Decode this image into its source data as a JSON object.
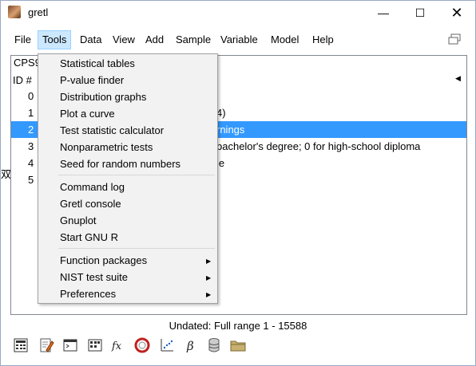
{
  "window": {
    "title": "gretl",
    "min_glyph": "—",
    "max_glyph": "☐",
    "close_glyph": "✕"
  },
  "menubar": {
    "items": [
      {
        "label": "File",
        "accel": "F"
      },
      {
        "label": "Tools",
        "accel": "T"
      },
      {
        "label": "Data",
        "accel": "D"
      },
      {
        "label": "View",
        "accel": "V"
      },
      {
        "label": "Add",
        "accel": "A"
      },
      {
        "label": "Sample",
        "accel": "S"
      },
      {
        "label": "Variable",
        "accel": "V"
      },
      {
        "label": "Model",
        "accel": "M"
      },
      {
        "label": "Help",
        "accel": "H"
      }
    ],
    "active": "Tools"
  },
  "main": {
    "dataset_label": "CPS9",
    "header_id": "ID #",
    "header_arrow": "◀",
    "rows": [
      {
        "idx": "0",
        "desc": ""
      },
      {
        "idx": "1",
        "desc": "4)"
      },
      {
        "idx": "2",
        "desc": "rnings"
      },
      {
        "idx": "3",
        "desc": "bachelor's degree; 0 for high-school diploma"
      },
      {
        "idx": "4",
        "desc": "le"
      },
      {
        "idx": "5",
        "desc": ""
      }
    ],
    "selected_row": "2"
  },
  "side_glyph": "双",
  "statusbar": {
    "text": "Undated: Full range 1 - 15588"
  },
  "toolbar": {
    "icons": [
      "calculator-icon",
      "edit-script-icon",
      "console-icon",
      "session-icon",
      "function-icon",
      "help-lifebuoy-icon",
      "plot-icon",
      "beta-model-icon",
      "database-icon",
      "folder-icon"
    ]
  },
  "tools_menu": {
    "groups": [
      [
        {
          "label": "Statistical tables"
        },
        {
          "label": "P-value finder"
        },
        {
          "label": "Distribution graphs"
        },
        {
          "label": "Plot a curve"
        },
        {
          "label": "Test statistic calculator"
        },
        {
          "label": "Nonparametric tests"
        },
        {
          "label": "Seed for random numbers"
        }
      ],
      [
        {
          "label": "Command log"
        },
        {
          "label": "Gretl console"
        },
        {
          "label": "Gnuplot"
        },
        {
          "label": "Start GNU R"
        }
      ],
      [
        {
          "label": "Function packages",
          "submenu": true
        },
        {
          "label": "NIST test suite",
          "submenu": true
        },
        {
          "label": "Preferences",
          "submenu": true
        }
      ]
    ],
    "submenu_arrow": "▶"
  }
}
